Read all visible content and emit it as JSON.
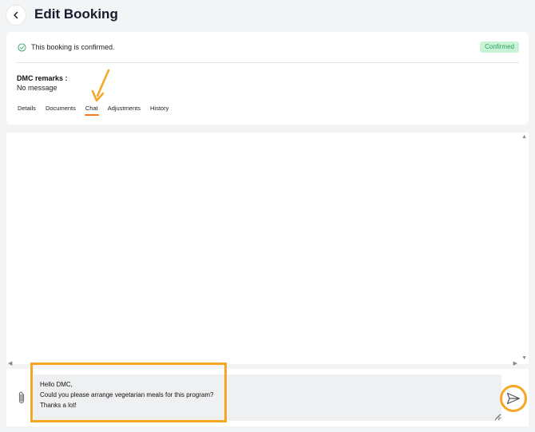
{
  "header": {
    "title": "Edit Booking"
  },
  "status": {
    "message": "This booking is confirmed.",
    "badge": "Confirmed"
  },
  "remarks": {
    "label": "DMC remarks :",
    "value": "No message"
  },
  "tabs": [
    {
      "label": "Details",
      "active": false
    },
    {
      "label": "Documents",
      "active": false
    },
    {
      "label": "Chat",
      "active": true
    },
    {
      "label": "Adjustments",
      "active": false
    },
    {
      "label": "History",
      "active": false
    }
  ],
  "compose": {
    "message": "Hello DMC,\nCould you please arrange vegetarian meals for this program?\nThanks a lot!"
  },
  "colors": {
    "accent": "#f6a623",
    "tab_underline": "#f47b20",
    "badge_bg": "#c9f3d6",
    "badge_text": "#2aa35c"
  },
  "icons": [
    "back-arrow-icon",
    "check-circle-icon",
    "paperclip-icon",
    "send-icon",
    "annotation-arrow-icon"
  ]
}
